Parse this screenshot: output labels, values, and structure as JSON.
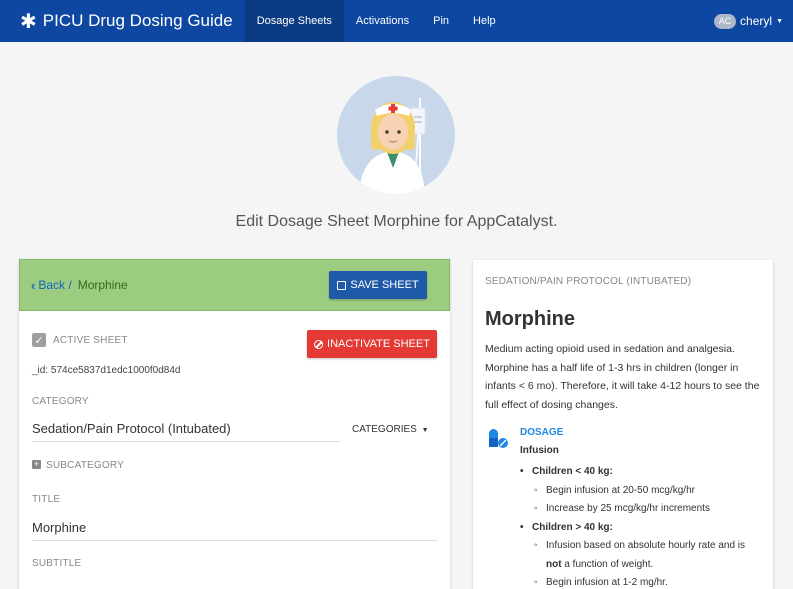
{
  "navbar": {
    "brand": "PICU Drug Dosing Guide",
    "items": [
      "Dosage Sheets",
      "Activations",
      "Pin",
      "Help"
    ],
    "active_index": 0,
    "user_initials": "AC",
    "user_name": "cheryl"
  },
  "page": {
    "heading": "Edit Dosage Sheet Morphine for AppCatalyst."
  },
  "form": {
    "breadcrumb_back": "Back /",
    "breadcrumb_current": "Morphine",
    "save_label": "SAVE SHEET",
    "active_label": "ACTIVE SHEET",
    "active_checked": true,
    "inactivate_label": "INACTIVATE SHEET",
    "id_text": "_id: 574ce5837d1edc1000f0d84d",
    "category_label": "CATEGORY",
    "category_value": "Sedation/Pain Protocol (Intubated)",
    "categories_btn": "CATEGORIES",
    "subcategory_label": "SUBCATEGORY",
    "title_label": "TITLE",
    "title_value": "Morphine",
    "subtitle_label": "SUBTITLE"
  },
  "preview": {
    "eyebrow": "SEDATION/PAIN PROTOCOL (INTUBATED)",
    "title": "Morphine",
    "description": "Medium acting opioid used in sedation and analgesia. Morphine has a half life of 1-3 hrs in children (longer in infants < 6 mo). Therefore, it will take 4-12 hours to see the full effect of dosing changes.",
    "dosage_heading": "DOSAGE",
    "dosage_sub": "Infusion",
    "group1_title": "Children < 40 kg:",
    "group1_items": [
      "Begin infusion at 20-50 mcg/kg/hr",
      "Increase by 25 mcg/kg/hr increments"
    ],
    "group2_title": "Children > 40 kg:",
    "group2_item1_a": "Infusion based on absolute hourly rate and is",
    "group2_item1_bold": "not",
    "group2_item1_b": "a function of weight.",
    "group2_item2": "Begin infusion at 1-2 mg/hr."
  },
  "colors": {
    "navbar": "#0d47a1",
    "header_green": "#9ccc80",
    "save_blue": "#1e5aa8",
    "inactivate_red": "#e53935",
    "accent_blue": "#1e88e5"
  },
  "icons": [
    "asterisk-icon",
    "caret-down-icon",
    "chevron-left-icon",
    "save-icon",
    "check-icon",
    "ban-icon",
    "plus-square-icon",
    "pill-icon"
  ]
}
